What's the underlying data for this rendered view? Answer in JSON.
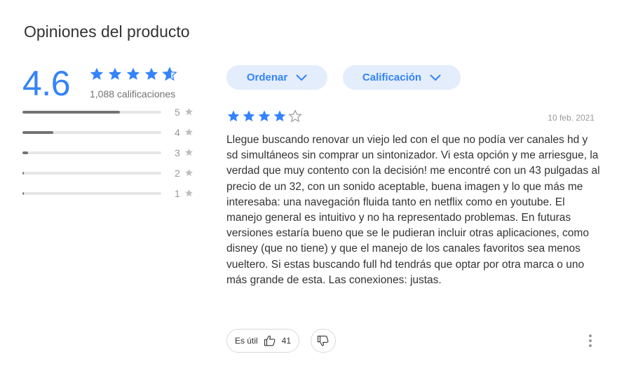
{
  "header": {
    "title": "Opiniones del producto"
  },
  "summary": {
    "average": "4.6",
    "average_value": 4.6,
    "count_text": "1,088 calificaciones",
    "star_color": "#3483fa",
    "distribution": [
      {
        "label": "5",
        "fraction": 0.7
      },
      {
        "label": "4",
        "fraction": 0.22
      },
      {
        "label": "3",
        "fraction": 0.04
      },
      {
        "label": "2",
        "fraction": 0.01
      },
      {
        "label": "1",
        "fraction": 0.01
      }
    ]
  },
  "filters": {
    "sort_label": "Ordenar",
    "rating_label": "Calificación"
  },
  "review": {
    "stars": 4,
    "date": "10 feb. 2021",
    "text": "Llegue buscando renovar un viejo led con el que no podía ver canales hd y sd simultáneos sin comprar un sintonizador. Vi esta opción y me arriesgue, la verdad que muy contento con la decisión! me encontré con un 43 pulgadas al precio de un 32, con un sonido aceptable, buena imagen y lo que más me interesaba: una navegación fluida tanto en netflix como en youtube. El manejo general es intuitivo y no ha representado problemas. En futuras versiones estaría bueno que se le pudieran incluir otras aplicaciones, como disney (que no tiene) y que el manejo de los canales favoritos sea menos vueltero. Si estas buscando full hd tendrás que optar por otra marca o uno más grande de esta. Las conexiones: justas.",
    "useful_label": "Es útil",
    "useful_count": "41"
  },
  "icons": {
    "star": "star-icon",
    "chevron": "chevron-down-icon",
    "thumb_up": "thumbs-up-icon",
    "thumb_down": "thumbs-down-icon",
    "more": "more-vertical-icon"
  }
}
